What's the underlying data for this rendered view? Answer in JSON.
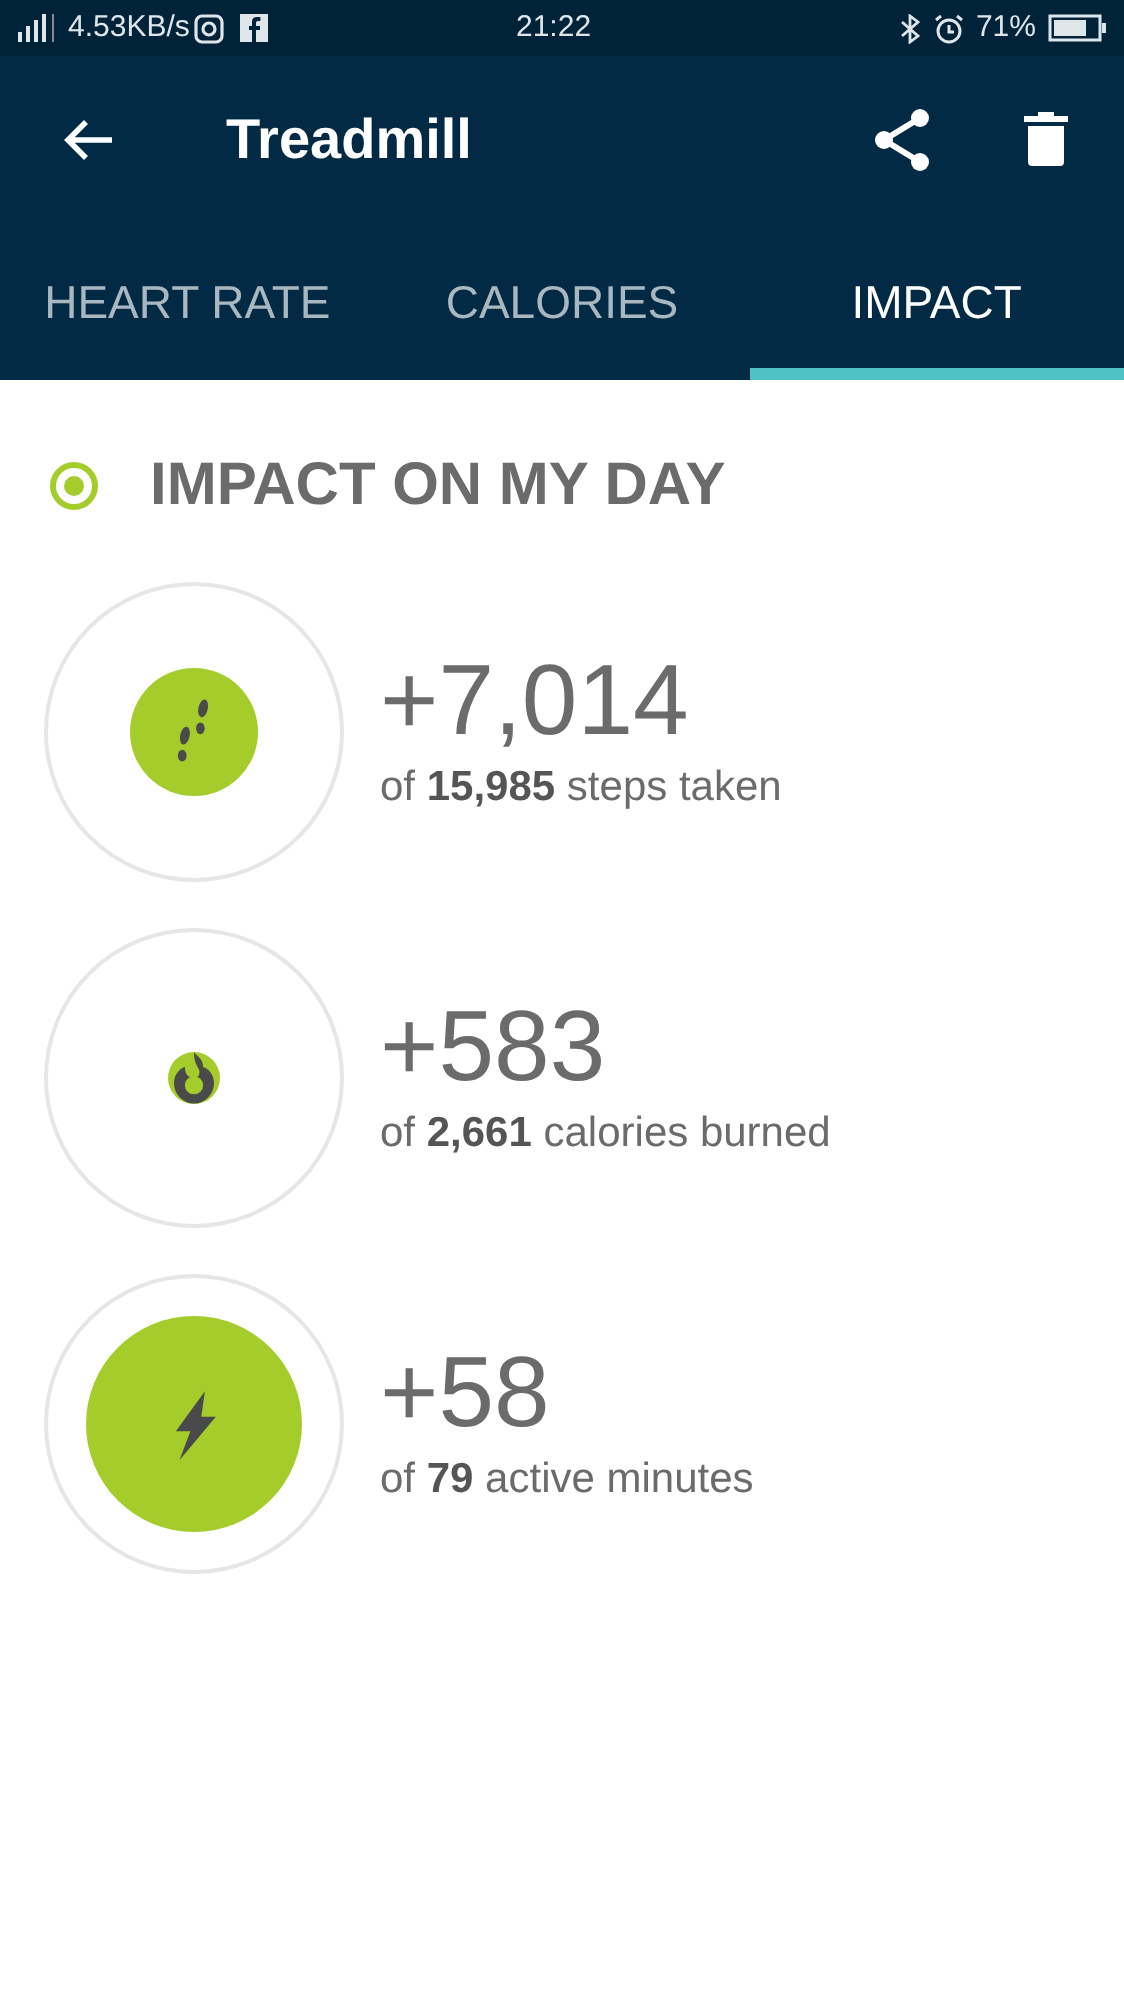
{
  "status_bar": {
    "network": "4.53KB/s",
    "time": "21:22",
    "battery": "71%"
  },
  "app_bar": {
    "title": "Treadmill"
  },
  "tabs": [
    {
      "label": "HEART RATE",
      "selected": false
    },
    {
      "label": "CALORIES",
      "selected": false
    },
    {
      "label": "IMPACT",
      "selected": true
    }
  ],
  "section": {
    "title": "IMPACT ON MY DAY"
  },
  "stats": [
    {
      "kind": "steps",
      "value": "+7,014",
      "detail": "of **15,985** steps taken"
    },
    {
      "kind": "calories",
      "value": "+583",
      "detail": "of **2,661** calories burned"
    },
    {
      "kind": "minutes",
      "value": "+58",
      "detail": "of **79** active minutes"
    }
  ]
}
